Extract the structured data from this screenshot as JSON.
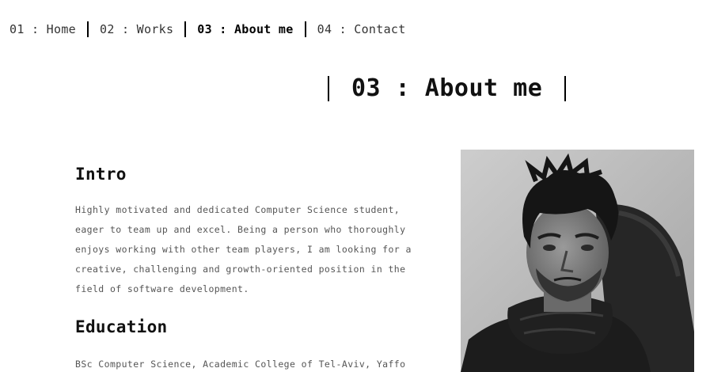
{
  "nav": {
    "items": [
      {
        "label": "01 : Home",
        "active": false
      },
      {
        "label": "02 : Works",
        "active": false
      },
      {
        "label": "03 : About me",
        "active": true
      },
      {
        "label": "04 : Contact",
        "active": false
      }
    ]
  },
  "page": {
    "title": "03 : About me"
  },
  "intro": {
    "heading": "Intro",
    "text": "Highly motivated and dedicated Computer Science student, eager to team up and excel. Being a person who thoroughly enjoys working with other team players, I am looking for a creative, challenging and growth-oriented position in the field of software development."
  },
  "education": {
    "heading": "Education",
    "text": "BSc Computer Science, Academic College of Tel-Aviv, Yaffo"
  },
  "colors": {
    "text": "#111111",
    "muted": "#555555",
    "background": "#ffffff"
  }
}
